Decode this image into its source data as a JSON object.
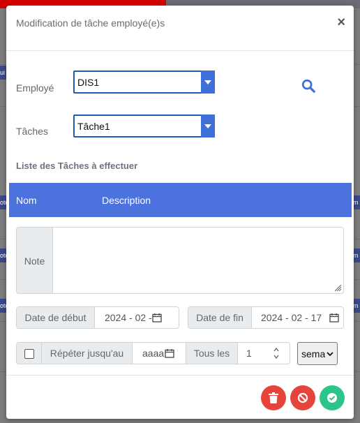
{
  "modal": {
    "title": "Modification de tâche employé(e)s",
    "close_label": "×"
  },
  "form": {
    "employee_label": "Employé",
    "employee_value": "DIS1",
    "tasks_label": "Tâches",
    "tasks_value": "Tâche1",
    "section_title": "Liste des Tâches à effectuer",
    "table_headers": [
      "Nom",
      "Description"
    ],
    "note_label": "Note",
    "note_value": "",
    "start_date_label": "Date de début",
    "start_date_value": "2024 - 02 -",
    "end_date_label": "Date de fin",
    "end_date_value": "2024 - 02 - 17",
    "repeat_label": "Répéter jusqu'au",
    "repeat_date_value": "aaaa",
    "every_label": "Tous les",
    "every_value": "1",
    "unit_value": "semaine"
  },
  "background": {
    "tab_fragments": [
      "ui",
      "ote",
      "m",
      "ote",
      "m",
      "ote",
      "m"
    ]
  },
  "colors": {
    "accent": "#4c72de",
    "delete": "#e5443a",
    "cancel": "#e5443a",
    "confirm": "#2bc48a"
  },
  "icons": {
    "search": "search-icon",
    "calendar": "calendar-icon",
    "delete": "trash-icon",
    "cancel": "ban-icon",
    "confirm": "check-circle-icon"
  }
}
